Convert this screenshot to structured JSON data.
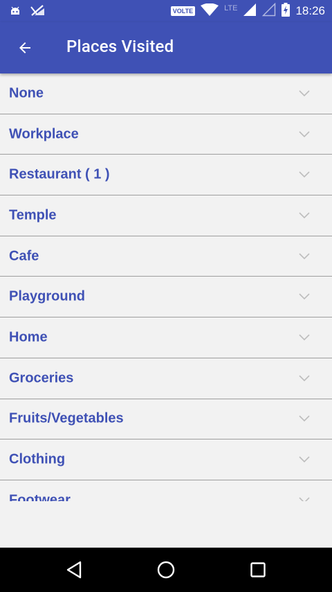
{
  "status_bar": {
    "network_badge": "VOLTE",
    "network_type": "LTE",
    "time": "18:26",
    "icons": [
      "android-notification-icon",
      "signal-off-icon",
      "wifi-icon",
      "cell-signal-icon",
      "cell-signal-empty-icon",
      "battery-charging-icon"
    ]
  },
  "app_bar": {
    "title": "Places Visited",
    "back_icon": "arrow-back-icon"
  },
  "places": {
    "items": [
      {
        "label": "None"
      },
      {
        "label": "Workplace"
      },
      {
        "label": "Restaurant ( 1 )"
      },
      {
        "label": "Temple"
      },
      {
        "label": "Cafe"
      },
      {
        "label": "Playground"
      },
      {
        "label": "Home"
      },
      {
        "label": "Groceries"
      },
      {
        "label": "Fruits/Vegetables"
      },
      {
        "label": "Clothing"
      },
      {
        "label": "Footwear"
      }
    ],
    "expand_icon": "chevron-down-icon"
  },
  "nav_bar": {
    "icons": [
      "back-triangle-icon",
      "home-circle-icon",
      "recents-square-icon"
    ]
  },
  "colors": {
    "primary": "#3f51b5",
    "background": "#f2f2f2",
    "divider": "#9e9e9e"
  }
}
